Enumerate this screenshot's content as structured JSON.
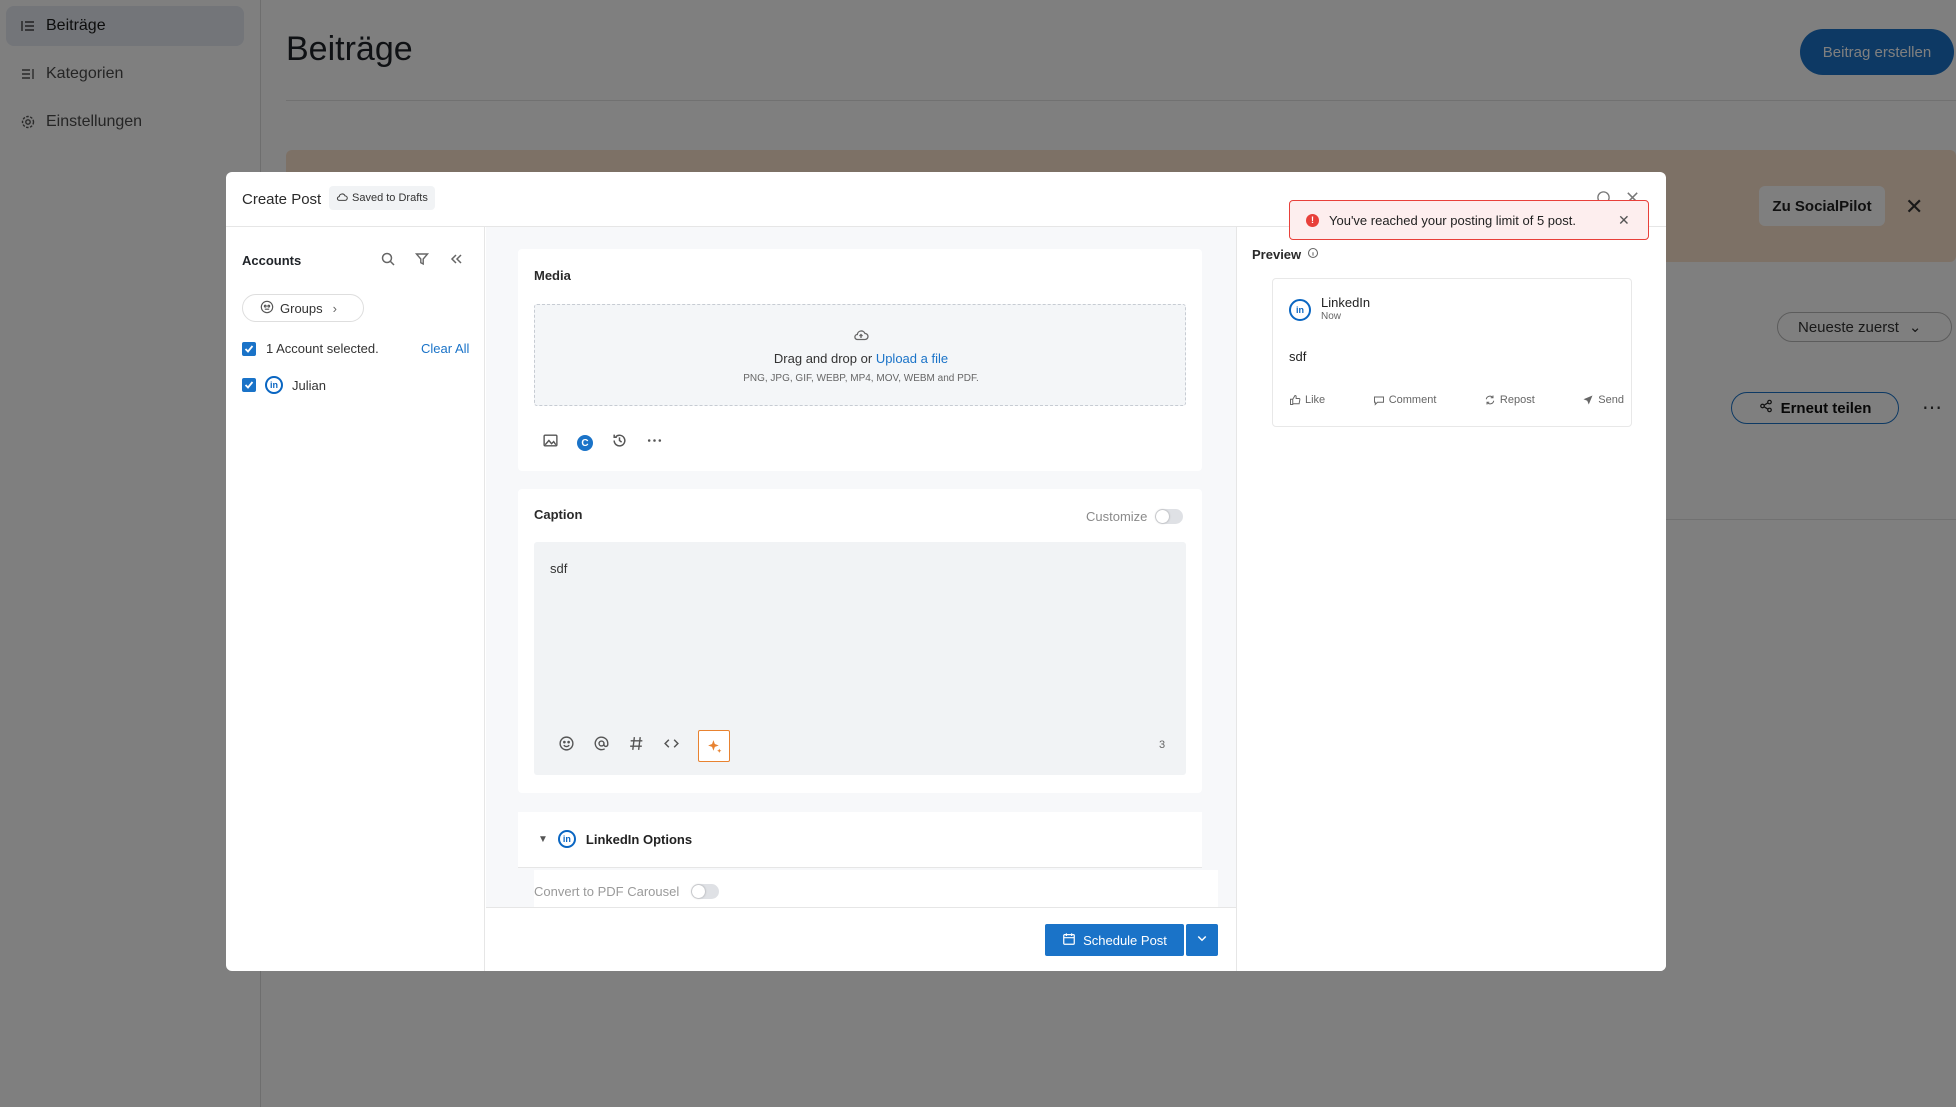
{
  "sidebar": {
    "items": [
      {
        "label": "Beiträge",
        "icon": "list-icon",
        "active": true
      },
      {
        "label": "Kategorien",
        "icon": "category-list-icon",
        "active": false
      },
      {
        "label": "Einstellungen",
        "icon": "gear-icon",
        "active": false
      }
    ]
  },
  "page": {
    "title": "Beiträge",
    "create_button": "Beitrag erstellen",
    "banner_button": "Zu SocialPilot",
    "sort_label": "Neueste zuerst",
    "share_button": "Erneut teilen"
  },
  "modal": {
    "title": "Create Post",
    "draft_badge": "Saved to Drafts",
    "accounts": {
      "title": "Accounts",
      "groups_label": "Groups",
      "selected_text": "1 Account selected.",
      "clear_all": "Clear All",
      "account_name": "Julian",
      "account_network": "LinkedIn"
    },
    "media": {
      "title": "Media",
      "drop_text": "Drag and drop or",
      "upload_link": "Upload a file",
      "formats": "PNG, JPG, GIF, WEBP, MP4, MOV, WEBM and PDF."
    },
    "caption": {
      "title": "Caption",
      "customize_label": "Customize",
      "text": "sdf",
      "char_count": "3"
    },
    "linkedin_options": {
      "title": "LinkedIn Options",
      "pdf_carousel_label": "Convert to PDF Carousel"
    },
    "schedule_button": "Schedule Post",
    "preview": {
      "title": "Preview",
      "network": "LinkedIn",
      "time": "Now",
      "text": "sdf",
      "actions": [
        "Like",
        "Comment",
        "Repost",
        "Send"
      ]
    },
    "toast": {
      "message": "You've reached your posting limit of 5 post."
    }
  },
  "colors": {
    "primary": "#1a73c8",
    "banner": "#fbe2cc",
    "error": "#e8403a",
    "ai_accent": "#e88230"
  }
}
